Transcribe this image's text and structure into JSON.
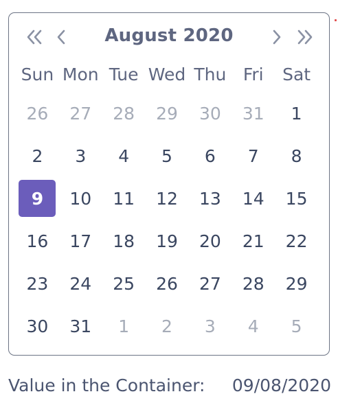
{
  "calendar": {
    "title": "August 2020",
    "weekdays": [
      "Sun",
      "Mon",
      "Tue",
      "Wed",
      "Thu",
      "Fri",
      "Sat"
    ],
    "weeks": [
      [
        {
          "d": "26",
          "o": true
        },
        {
          "d": "27",
          "o": true
        },
        {
          "d": "28",
          "o": true
        },
        {
          "d": "29",
          "o": true
        },
        {
          "d": "30",
          "o": true
        },
        {
          "d": "31",
          "o": true
        },
        {
          "d": "1",
          "o": false
        }
      ],
      [
        {
          "d": "2",
          "o": false
        },
        {
          "d": "3",
          "o": false
        },
        {
          "d": "4",
          "o": false
        },
        {
          "d": "5",
          "o": false
        },
        {
          "d": "6",
          "o": false
        },
        {
          "d": "7",
          "o": false
        },
        {
          "d": "8",
          "o": false
        }
      ],
      [
        {
          "d": "9",
          "o": false,
          "s": true
        },
        {
          "d": "10",
          "o": false
        },
        {
          "d": "11",
          "o": false
        },
        {
          "d": "12",
          "o": false
        },
        {
          "d": "13",
          "o": false
        },
        {
          "d": "14",
          "o": false
        },
        {
          "d": "15",
          "o": false
        }
      ],
      [
        {
          "d": "16",
          "o": false
        },
        {
          "d": "17",
          "o": false
        },
        {
          "d": "18",
          "o": false
        },
        {
          "d": "19",
          "o": false
        },
        {
          "d": "20",
          "o": false
        },
        {
          "d": "21",
          "o": false
        },
        {
          "d": "22",
          "o": false
        }
      ],
      [
        {
          "d": "23",
          "o": false
        },
        {
          "d": "24",
          "o": false
        },
        {
          "d": "25",
          "o": false
        },
        {
          "d": "26",
          "o": false
        },
        {
          "d": "27",
          "o": false
        },
        {
          "d": "28",
          "o": false
        },
        {
          "d": "29",
          "o": false
        }
      ],
      [
        {
          "d": "30",
          "o": false
        },
        {
          "d": "31",
          "o": false
        },
        {
          "d": "1",
          "o": true
        },
        {
          "d": "2",
          "o": true
        },
        {
          "d": "3",
          "o": true
        },
        {
          "d": "4",
          "o": true
        },
        {
          "d": "5",
          "o": true
        }
      ]
    ],
    "nav_icons": [
      "double-chevron-left-icon",
      "chevron-left-icon",
      "chevron-right-icon",
      "double-chevron-right-icon"
    ]
  },
  "footer": {
    "label": "Value in the Container:",
    "value": "09/08/2020"
  },
  "colors": {
    "accent": "#6b5dbb",
    "text": "#3a4660",
    "muted": "#a6acb8",
    "border": "#6b7384"
  }
}
